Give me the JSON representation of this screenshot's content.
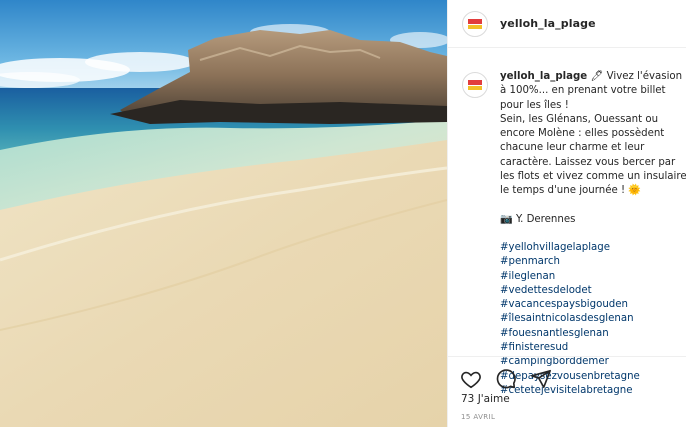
{
  "post": {
    "username": "yelloh_la_plage",
    "caption_line1": "Vivez l'évasion à 100%... en prenant votre billet pour les îles !",
    "caption_line2": "Sein, les Glénans, Ouessant ou encore Molène : elles possèdent chacune leur charme et leur caractère. Laissez vous bercer par les flots et vivez comme un insulaire le temps d'une journée !",
    "photo_credit": "Y. Derennes",
    "hashtags": [
      "#yellohvillagelaplage",
      "#penmarch",
      "#ileglenan",
      "#vedettesdelodet",
      "#vacancespaysbigouden",
      "#îlesaintnicolasdesglenan",
      "#fouesnantlesglenan",
      "#finisteresud",
      "#campingborddemer",
      "#depaysezvousenbretagne",
      "#cetetejevisitelabretagne"
    ],
    "likes": "73 J'aime",
    "date": "15 AVRIL"
  },
  "icons": {
    "pen": "pen-icon",
    "sun": "sun-emoji-icon",
    "camera": "camera-icon",
    "like": "heart-icon",
    "comment": "comment-icon",
    "share": "paper-plane-icon"
  },
  "colors": {
    "hashtag": "#00376b",
    "text": "#262626",
    "muted": "#8e8e8e",
    "border": "#efefef"
  }
}
